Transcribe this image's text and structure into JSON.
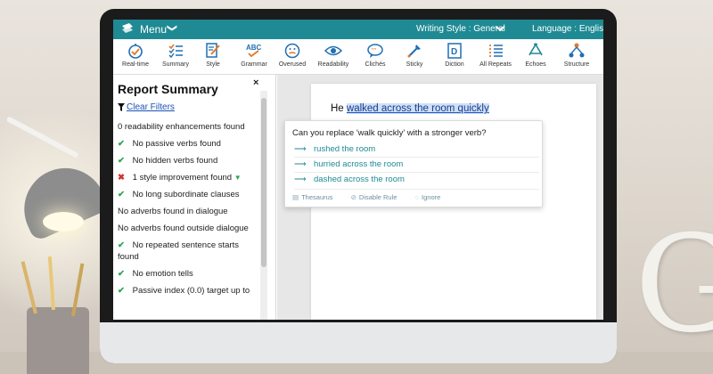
{
  "menubar": {
    "menu_label": "Menu",
    "menu_chevron": "❯",
    "writing_style": "Writing Style : General",
    "ws_chevron": "❯",
    "language": "Language : English"
  },
  "toolbar": {
    "items": [
      {
        "label": "Real-time",
        "icon": "realtime-icon"
      },
      {
        "label": "Summary",
        "icon": "summary-icon"
      },
      {
        "label": "Style",
        "icon": "style-icon"
      },
      {
        "label": "Grammar",
        "icon": "grammar-icon"
      },
      {
        "label": "Overused",
        "icon": "overused-icon"
      },
      {
        "label": "Readability",
        "icon": "readability-icon"
      },
      {
        "label": "Clichés",
        "icon": "cliches-icon"
      },
      {
        "label": "Sticky",
        "icon": "sticky-icon"
      },
      {
        "label": "Diction",
        "icon": "diction-icon"
      },
      {
        "label": "All Repeats",
        "icon": "all-repeats-icon"
      },
      {
        "label": "Echoes",
        "icon": "echoes-icon"
      },
      {
        "label": "Structure",
        "icon": "structure-icon"
      }
    ],
    "icon_color": "#1f6fb3",
    "grammar_text": "ABC"
  },
  "report": {
    "title": "Report Summary",
    "close": "×",
    "clear_filters": "Clear Filters",
    "items": [
      {
        "text": "0 readability enhancements found",
        "status": "none"
      },
      {
        "text": "No passive verbs found",
        "status": "ok"
      },
      {
        "text": "No hidden verbs found",
        "status": "ok"
      },
      {
        "text": "1 style improvement found",
        "status": "bad"
      },
      {
        "text": "No long subordinate clauses",
        "status": "ok"
      },
      {
        "text": "No adverbs found in dialogue",
        "status": "none"
      },
      {
        "text": "No adverbs found outside dialogue",
        "status": "none"
      },
      {
        "text": "No repeated sentence starts",
        "text2": "found",
        "status": "ok"
      },
      {
        "text": "No emotion tells",
        "status": "ok"
      },
      {
        "text": "Passive index (0.0) target up to",
        "status": "ok"
      }
    ],
    "ok_mark": "✔",
    "bad_mark": "✖",
    "caret": "▼",
    "colors": {
      "ok": "#2ea44f",
      "bad": "#d0312d",
      "link": "#1a52b8"
    }
  },
  "document": {
    "before": "He ",
    "highlighted": "walked across the room quickly"
  },
  "popup": {
    "question": "Can you replace 'walk quickly' with a stronger verb?",
    "arrow": "⟶",
    "suggestions": [
      "rushed the room",
      "hurried across the room",
      "dashed across the room"
    ],
    "actions": {
      "thesaurus": "Thesaurus",
      "disable": "Disable Rule",
      "ignore": "Ignore"
    }
  },
  "brand_color": "#1f8a94"
}
